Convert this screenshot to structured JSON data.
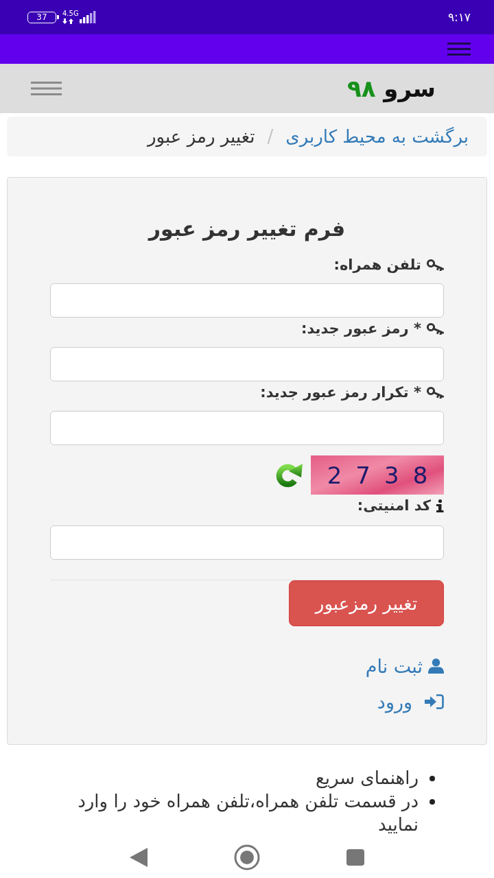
{
  "status_bar": {
    "battery": "37",
    "network": "4.5G",
    "time": "۹:۱۷"
  },
  "navbar": {
    "logo": {
      "name": "سرو",
      "number": "۹۸"
    }
  },
  "breadcrumb": {
    "items": [
      {
        "label": "برگشت به محیط کاربری",
        "kind": "link"
      },
      {
        "label": "تغییر رمز عبور",
        "kind": "current"
      }
    ],
    "separator": "/"
  },
  "form": {
    "title": "فرم تغییر رمز عبور",
    "fields": [
      {
        "label": "تلفن همراه:"
      },
      {
        "label": "* رمز عبور جدید:"
      },
      {
        "label": "* تکرار رمز عبور جدید:"
      }
    ],
    "captcha": {
      "code": "2738",
      "label": "کد امنیتی:"
    },
    "submit": "تغییر رمزعبور",
    "links": [
      {
        "label": "ثبت نام",
        "kind": "register"
      },
      {
        "label": "ورود",
        "kind": "login"
      }
    ]
  },
  "help": [
    "راهنمای سریع",
    "در قسمت تلفن همراه،تلفن همراه خود را وارد نمایید"
  ]
}
